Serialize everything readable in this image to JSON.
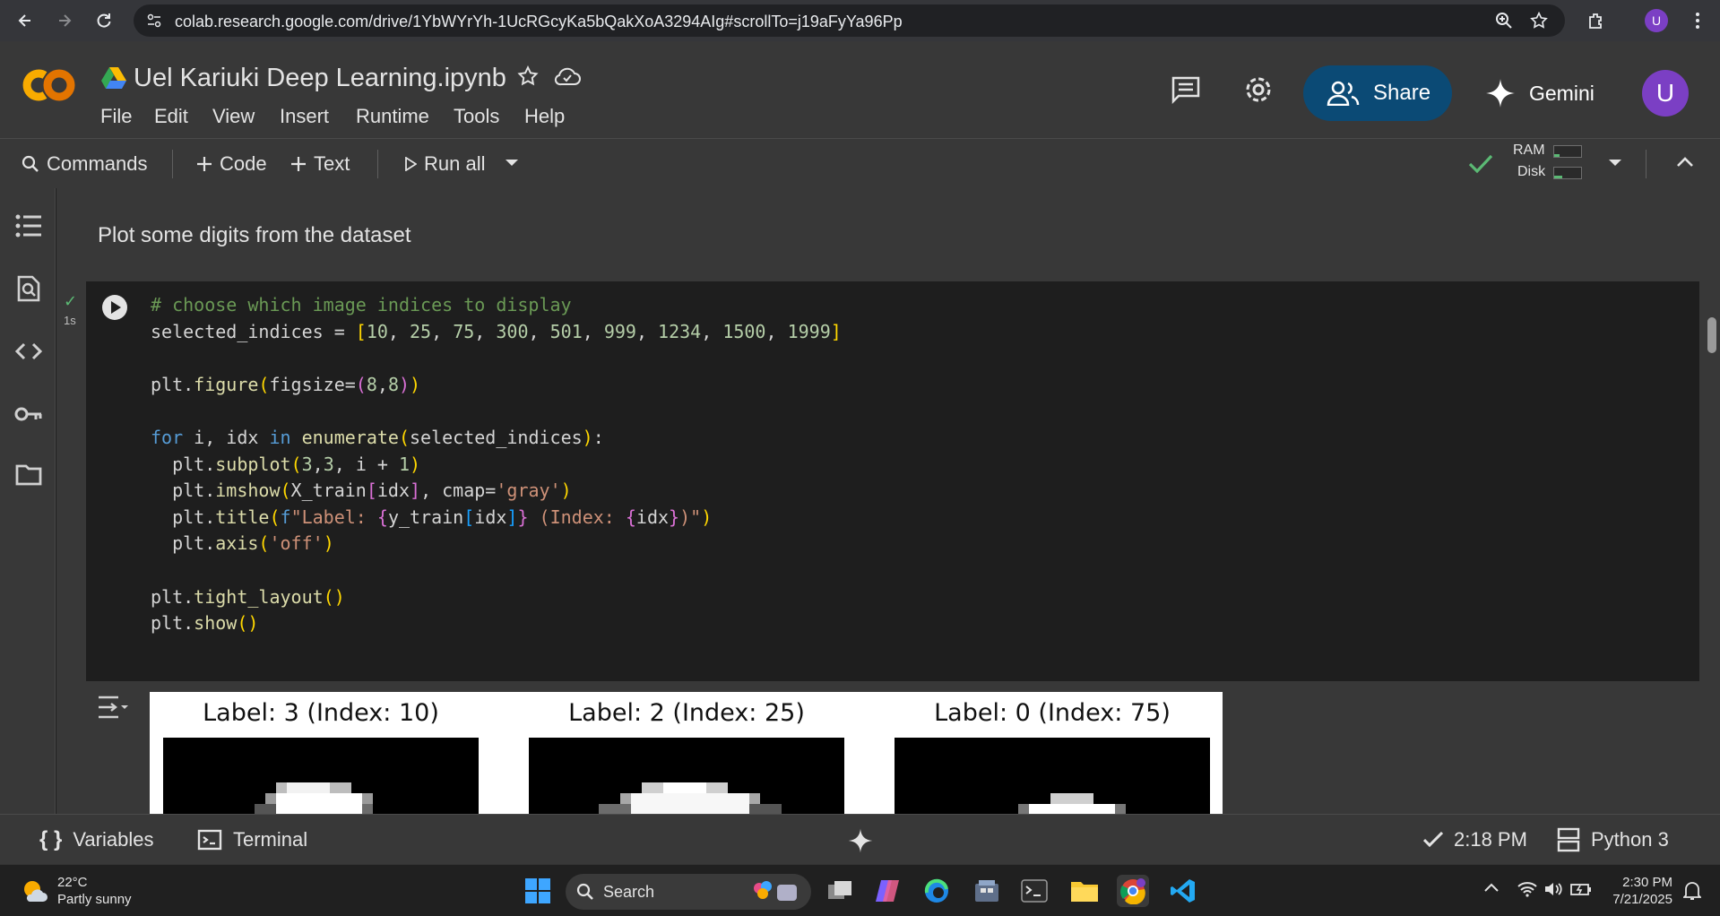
{
  "browser": {
    "url": "colab.research.google.com/drive/1YbWYrYh-1UcRGcyKa5bQakXoA3294AIg#scrollTo=j19aFyYa96Pp",
    "profile_initial": "U"
  },
  "header": {
    "filename": "Uel Kariuki Deep Learning.ipynb",
    "menu": [
      "File",
      "Edit",
      "View",
      "Insert",
      "Runtime",
      "Tools",
      "Help"
    ],
    "share_label": "Share",
    "gemini_label": "Gemini",
    "user_initial": "U"
  },
  "toolbar": {
    "commands_label": "Commands",
    "code_label": "Code",
    "text_label": "Text",
    "run_all_label": "Run all",
    "ram_label": "RAM",
    "disk_label": "Disk",
    "ram_usage": 0.2,
    "disk_usage": 0.3
  },
  "notebook": {
    "text_cell": "Plot some digits from the dataset",
    "code_cell": {
      "exec_time": "1s"
    },
    "output": {
      "subplots": [
        {
          "title": "Label: 3 (Index: 10)"
        },
        {
          "title": "Label: 2 (Index: 25)"
        },
        {
          "title": "Label: 0 (Index: 75)"
        }
      ]
    }
  },
  "statusbar": {
    "variables_label": "Variables",
    "terminal_label": "Terminal",
    "last_run": "2:18 PM",
    "runtime": "Python 3"
  },
  "taskbar": {
    "temperature": "22°C",
    "weather": "Partly sunny",
    "search_label": "Search",
    "time": "2:30 PM",
    "date": "7/21/2025"
  },
  "colors": {
    "share_bg": "#0b4a75",
    "avatar": "#7b3fc4",
    "success": "#5bb974"
  }
}
